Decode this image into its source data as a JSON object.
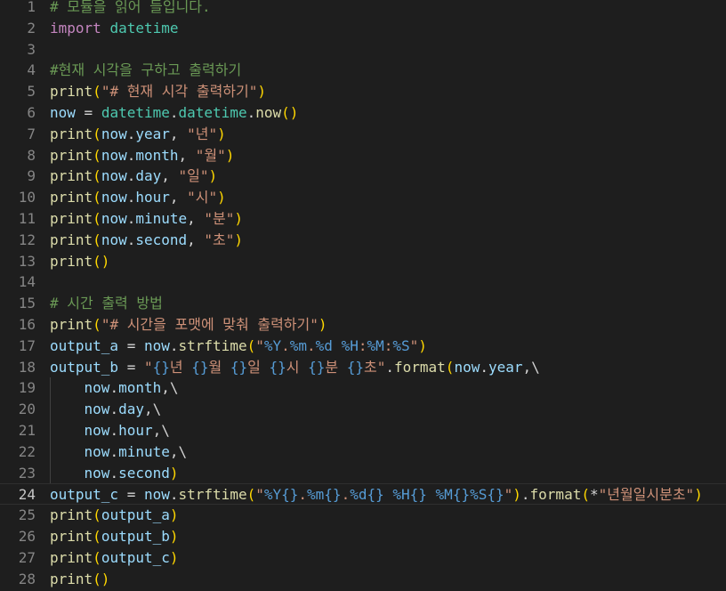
{
  "editor": {
    "colors": {
      "background": "#1e1e1e",
      "line_number": "#858585",
      "keyword": "#c586c0",
      "function": "#dcdcaa",
      "variable": "#9cdcfe",
      "class": "#4ec9b0",
      "string": "#ce9178",
      "format_specifier": "#569cd6",
      "comment": "#6a9955",
      "bracket_level_1": "#ffd700",
      "bracket_level_2": "#da70d6",
      "bracket_level_3": "#179fff"
    },
    "current_line": 24,
    "lines": [
      {
        "num": "1",
        "tokens": [
          {
            "t": "# 모듈을 읽어 들입니다.",
            "c": "cmt"
          }
        ]
      },
      {
        "num": "2",
        "tokens": [
          {
            "t": "import",
            "c": "kw"
          },
          {
            "t": " ",
            "c": "op"
          },
          {
            "t": "datetime",
            "c": "cls"
          }
        ]
      },
      {
        "num": "3",
        "tokens": []
      },
      {
        "num": "4",
        "tokens": [
          {
            "t": "#현재 시각을 구하고 출력하기",
            "c": "cmt"
          }
        ]
      },
      {
        "num": "5",
        "tokens": [
          {
            "t": "print",
            "c": "fn"
          },
          {
            "t": "(",
            "c": "p1"
          },
          {
            "t": "\"# 현재 시각 출력하기\"",
            "c": "str"
          },
          {
            "t": ")",
            "c": "p1"
          }
        ]
      },
      {
        "num": "6",
        "tokens": [
          {
            "t": "now",
            "c": "var"
          },
          {
            "t": " = ",
            "c": "op"
          },
          {
            "t": "datetime",
            "c": "cls"
          },
          {
            "t": ".",
            "c": "op"
          },
          {
            "t": "datetime",
            "c": "cls"
          },
          {
            "t": ".",
            "c": "op"
          },
          {
            "t": "now",
            "c": "fn"
          },
          {
            "t": "()",
            "c": "p1"
          }
        ]
      },
      {
        "num": "7",
        "tokens": [
          {
            "t": "print",
            "c": "fn"
          },
          {
            "t": "(",
            "c": "p1"
          },
          {
            "t": "now",
            "c": "var"
          },
          {
            "t": ".",
            "c": "op"
          },
          {
            "t": "year",
            "c": "var"
          },
          {
            "t": ", ",
            "c": "op"
          },
          {
            "t": "\"년\"",
            "c": "str"
          },
          {
            "t": ")",
            "c": "p1"
          }
        ]
      },
      {
        "num": "8",
        "tokens": [
          {
            "t": "print",
            "c": "fn"
          },
          {
            "t": "(",
            "c": "p1"
          },
          {
            "t": "now",
            "c": "var"
          },
          {
            "t": ".",
            "c": "op"
          },
          {
            "t": "month",
            "c": "var"
          },
          {
            "t": ", ",
            "c": "op"
          },
          {
            "t": "\"월\"",
            "c": "str"
          },
          {
            "t": ")",
            "c": "p1"
          }
        ]
      },
      {
        "num": "9",
        "tokens": [
          {
            "t": "print",
            "c": "fn"
          },
          {
            "t": "(",
            "c": "p1"
          },
          {
            "t": "now",
            "c": "var"
          },
          {
            "t": ".",
            "c": "op"
          },
          {
            "t": "day",
            "c": "var"
          },
          {
            "t": ", ",
            "c": "op"
          },
          {
            "t": "\"일\"",
            "c": "str"
          },
          {
            "t": ")",
            "c": "p1"
          }
        ]
      },
      {
        "num": "10",
        "tokens": [
          {
            "t": "print",
            "c": "fn"
          },
          {
            "t": "(",
            "c": "p1"
          },
          {
            "t": "now",
            "c": "var"
          },
          {
            "t": ".",
            "c": "op"
          },
          {
            "t": "hour",
            "c": "var"
          },
          {
            "t": ", ",
            "c": "op"
          },
          {
            "t": "\"시\"",
            "c": "str"
          },
          {
            "t": ")",
            "c": "p1"
          }
        ]
      },
      {
        "num": "11",
        "tokens": [
          {
            "t": "print",
            "c": "fn"
          },
          {
            "t": "(",
            "c": "p1"
          },
          {
            "t": "now",
            "c": "var"
          },
          {
            "t": ".",
            "c": "op"
          },
          {
            "t": "minute",
            "c": "var"
          },
          {
            "t": ", ",
            "c": "op"
          },
          {
            "t": "\"분\"",
            "c": "str"
          },
          {
            "t": ")",
            "c": "p1"
          }
        ]
      },
      {
        "num": "12",
        "tokens": [
          {
            "t": "print",
            "c": "fn"
          },
          {
            "t": "(",
            "c": "p1"
          },
          {
            "t": "now",
            "c": "var"
          },
          {
            "t": ".",
            "c": "op"
          },
          {
            "t": "second",
            "c": "var"
          },
          {
            "t": ", ",
            "c": "op"
          },
          {
            "t": "\"초\"",
            "c": "str"
          },
          {
            "t": ")",
            "c": "p1"
          }
        ]
      },
      {
        "num": "13",
        "tokens": [
          {
            "t": "print",
            "c": "fn"
          },
          {
            "t": "()",
            "c": "p1"
          }
        ]
      },
      {
        "num": "14",
        "tokens": []
      },
      {
        "num": "15",
        "tokens": [
          {
            "t": "# 시간 출력 방법",
            "c": "cmt"
          }
        ]
      },
      {
        "num": "16",
        "tokens": [
          {
            "t": "print",
            "c": "fn"
          },
          {
            "t": "(",
            "c": "p1"
          },
          {
            "t": "\"# 시간을 포맷에 맞춰 출력하기\"",
            "c": "str"
          },
          {
            "t": ")",
            "c": "p1"
          }
        ]
      },
      {
        "num": "17",
        "tokens": [
          {
            "t": "output_a",
            "c": "var"
          },
          {
            "t": " = ",
            "c": "op"
          },
          {
            "t": "now",
            "c": "var"
          },
          {
            "t": ".",
            "c": "op"
          },
          {
            "t": "strftime",
            "c": "fn"
          },
          {
            "t": "(",
            "c": "p1"
          },
          {
            "t": "\"",
            "c": "str"
          },
          {
            "t": "%Y",
            "c": "esc"
          },
          {
            "t": ".",
            "c": "str"
          },
          {
            "t": "%m",
            "c": "esc"
          },
          {
            "t": ".",
            "c": "str"
          },
          {
            "t": "%d",
            "c": "esc"
          },
          {
            "t": " ",
            "c": "str"
          },
          {
            "t": "%H",
            "c": "esc"
          },
          {
            "t": ":",
            "c": "str"
          },
          {
            "t": "%M",
            "c": "esc"
          },
          {
            "t": ":",
            "c": "str"
          },
          {
            "t": "%S",
            "c": "esc"
          },
          {
            "t": "\"",
            "c": "str"
          },
          {
            "t": ")",
            "c": "p1"
          }
        ]
      },
      {
        "num": "18",
        "tokens": [
          {
            "t": "output_b",
            "c": "var"
          },
          {
            "t": " = ",
            "c": "op"
          },
          {
            "t": "\"",
            "c": "str"
          },
          {
            "t": "{}",
            "c": "esc"
          },
          {
            "t": "년 ",
            "c": "str"
          },
          {
            "t": "{}",
            "c": "esc"
          },
          {
            "t": "월 ",
            "c": "str"
          },
          {
            "t": "{}",
            "c": "esc"
          },
          {
            "t": "일 ",
            "c": "str"
          },
          {
            "t": "{}",
            "c": "esc"
          },
          {
            "t": "시 ",
            "c": "str"
          },
          {
            "t": "{}",
            "c": "esc"
          },
          {
            "t": "분 ",
            "c": "str"
          },
          {
            "t": "{}",
            "c": "esc"
          },
          {
            "t": "초\"",
            "c": "str"
          },
          {
            "t": ".",
            "c": "op"
          },
          {
            "t": "format",
            "c": "fn"
          },
          {
            "t": "(",
            "c": "p1"
          },
          {
            "t": "now",
            "c": "var"
          },
          {
            "t": ".",
            "c": "op"
          },
          {
            "t": "year",
            "c": "var"
          },
          {
            "t": ",\\",
            "c": "op"
          }
        ]
      },
      {
        "num": "19",
        "tokens": [
          {
            "t": "    ",
            "c": "op"
          },
          {
            "t": "now",
            "c": "var"
          },
          {
            "t": ".",
            "c": "op"
          },
          {
            "t": "month",
            "c": "var"
          },
          {
            "t": ",\\",
            "c": "op"
          }
        ]
      },
      {
        "num": "20",
        "tokens": [
          {
            "t": "    ",
            "c": "op"
          },
          {
            "t": "now",
            "c": "var"
          },
          {
            "t": ".",
            "c": "op"
          },
          {
            "t": "day",
            "c": "var"
          },
          {
            "t": ",\\",
            "c": "op"
          }
        ]
      },
      {
        "num": "21",
        "tokens": [
          {
            "t": "    ",
            "c": "op"
          },
          {
            "t": "now",
            "c": "var"
          },
          {
            "t": ".",
            "c": "op"
          },
          {
            "t": "hour",
            "c": "var"
          },
          {
            "t": ",\\",
            "c": "op"
          }
        ]
      },
      {
        "num": "22",
        "tokens": [
          {
            "t": "    ",
            "c": "op"
          },
          {
            "t": "now",
            "c": "var"
          },
          {
            "t": ".",
            "c": "op"
          },
          {
            "t": "minute",
            "c": "var"
          },
          {
            "t": ",\\",
            "c": "op"
          }
        ]
      },
      {
        "num": "23",
        "tokens": [
          {
            "t": "    ",
            "c": "op"
          },
          {
            "t": "now",
            "c": "var"
          },
          {
            "t": ".",
            "c": "op"
          },
          {
            "t": "second",
            "c": "var"
          },
          {
            "t": ")",
            "c": "p1"
          }
        ]
      },
      {
        "num": "24",
        "tokens": [
          {
            "t": "output_c",
            "c": "var"
          },
          {
            "t": " = ",
            "c": "op"
          },
          {
            "t": "now",
            "c": "var"
          },
          {
            "t": ".",
            "c": "op"
          },
          {
            "t": "strftime",
            "c": "fn"
          },
          {
            "t": "(",
            "c": "p1"
          },
          {
            "t": "\"",
            "c": "str"
          },
          {
            "t": "%Y",
            "c": "esc"
          },
          {
            "t": "{}",
            "c": "esc"
          },
          {
            "t": ".",
            "c": "str"
          },
          {
            "t": "%m",
            "c": "esc"
          },
          {
            "t": "{}",
            "c": "esc"
          },
          {
            "t": ".",
            "c": "str"
          },
          {
            "t": "%d",
            "c": "esc"
          },
          {
            "t": "{}",
            "c": "esc"
          },
          {
            "t": " ",
            "c": "str"
          },
          {
            "t": "%H",
            "c": "esc"
          },
          {
            "t": "{}",
            "c": "esc"
          },
          {
            "t": " ",
            "c": "str"
          },
          {
            "t": "%M",
            "c": "esc"
          },
          {
            "t": "{}",
            "c": "esc"
          },
          {
            "t": "%S",
            "c": "esc"
          },
          {
            "t": "{}",
            "c": "esc"
          },
          {
            "t": "\"",
            "c": "str"
          },
          {
            "t": ")",
            "c": "p1"
          },
          {
            "t": ".",
            "c": "op"
          },
          {
            "t": "format",
            "c": "fn"
          },
          {
            "t": "(",
            "c": "p1"
          },
          {
            "t": "*",
            "c": "op"
          },
          {
            "t": "\"년월일시분초\"",
            "c": "str"
          },
          {
            "t": ")",
            "c": "p1"
          }
        ]
      },
      {
        "num": "25",
        "tokens": [
          {
            "t": "print",
            "c": "fn"
          },
          {
            "t": "(",
            "c": "p1"
          },
          {
            "t": "output_a",
            "c": "var"
          },
          {
            "t": ")",
            "c": "p1"
          }
        ]
      },
      {
        "num": "26",
        "tokens": [
          {
            "t": "print",
            "c": "fn"
          },
          {
            "t": "(",
            "c": "p1"
          },
          {
            "t": "output_b",
            "c": "var"
          },
          {
            "t": ")",
            "c": "p1"
          }
        ]
      },
      {
        "num": "27",
        "tokens": [
          {
            "t": "print",
            "c": "fn"
          },
          {
            "t": "(",
            "c": "p1"
          },
          {
            "t": "output_c",
            "c": "var"
          },
          {
            "t": ")",
            "c": "p1"
          }
        ]
      },
      {
        "num": "28",
        "tokens": [
          {
            "t": "print",
            "c": "fn"
          },
          {
            "t": "()",
            "c": "p1"
          }
        ]
      }
    ]
  }
}
